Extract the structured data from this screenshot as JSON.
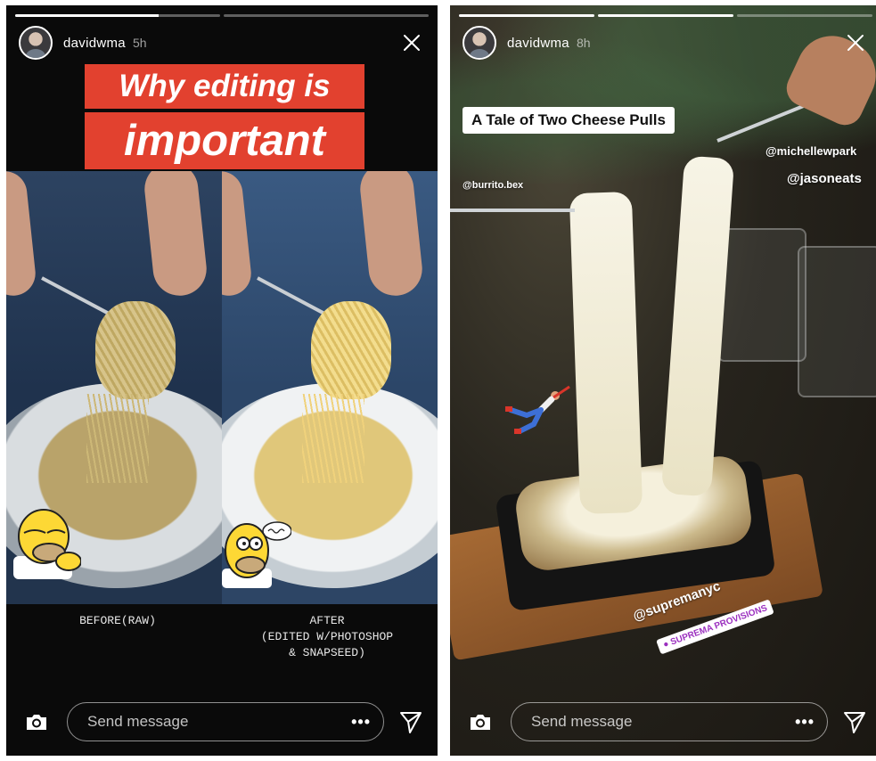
{
  "stories": [
    {
      "progress": [
        0.7,
        0.0
      ],
      "username": "davidwma",
      "time": "5h",
      "title_line1": "Why editing is",
      "title_line2": "important",
      "before_caption": "BEFORE(RAW)",
      "after_caption": "AFTER\n(EDITED W/PHOTOSHOP\n& SNAPSEED)",
      "message_placeholder": "Send message",
      "more_label": "•••"
    },
    {
      "progress": [
        1.0,
        1.0,
        0.0
      ],
      "username": "davidwma",
      "time": "8h",
      "title": "A Tale of Two Cheese Pulls",
      "mentions": {
        "burrito": "@burrito.bex",
        "michelle": "@michellewpark",
        "jason": "@jasoneats",
        "suprema": "@supremanyc"
      },
      "location": "● SUPREMA PROVISIONS",
      "message_placeholder": "Send message",
      "more_label": "•••"
    }
  ],
  "icons": {
    "close": "close-icon",
    "camera": "camera-icon",
    "send": "send-icon"
  },
  "colors": {
    "title_red": "#e2412f",
    "story_bg": "#0a0a0a"
  }
}
